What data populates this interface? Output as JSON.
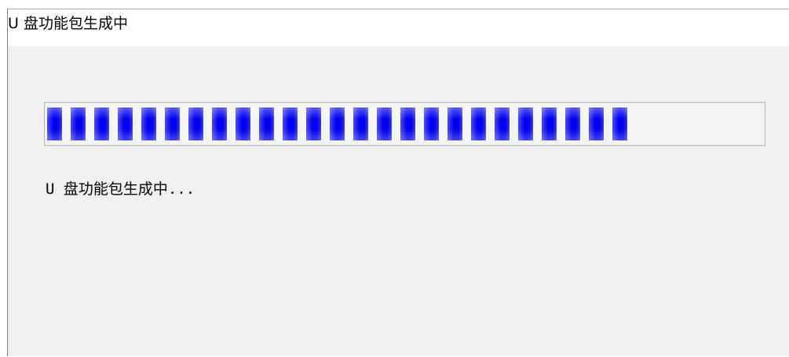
{
  "window": {
    "title": "U 盘功能包生成中"
  },
  "progress": {
    "fraction": 0.82
  },
  "status": {
    "text": "U 盘功能包生成中..."
  },
  "colors": {
    "progress_fill": "#0000f0",
    "background": "#f0f0f0",
    "titlebar": "#ffffff"
  }
}
